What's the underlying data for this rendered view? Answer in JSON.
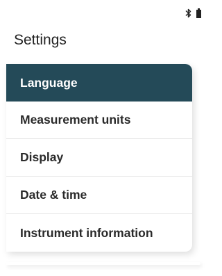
{
  "header": {
    "title": "Settings"
  },
  "status_bar": {
    "icons": [
      "bluetooth-icon",
      "battery-icon"
    ]
  },
  "menu": {
    "selected_index": 0,
    "selected_color": "#244a58",
    "items": [
      {
        "label": "Language"
      },
      {
        "label": "Measurement units"
      },
      {
        "label": "Display"
      },
      {
        "label": "Date & time"
      },
      {
        "label": "Instrument information"
      }
    ]
  }
}
